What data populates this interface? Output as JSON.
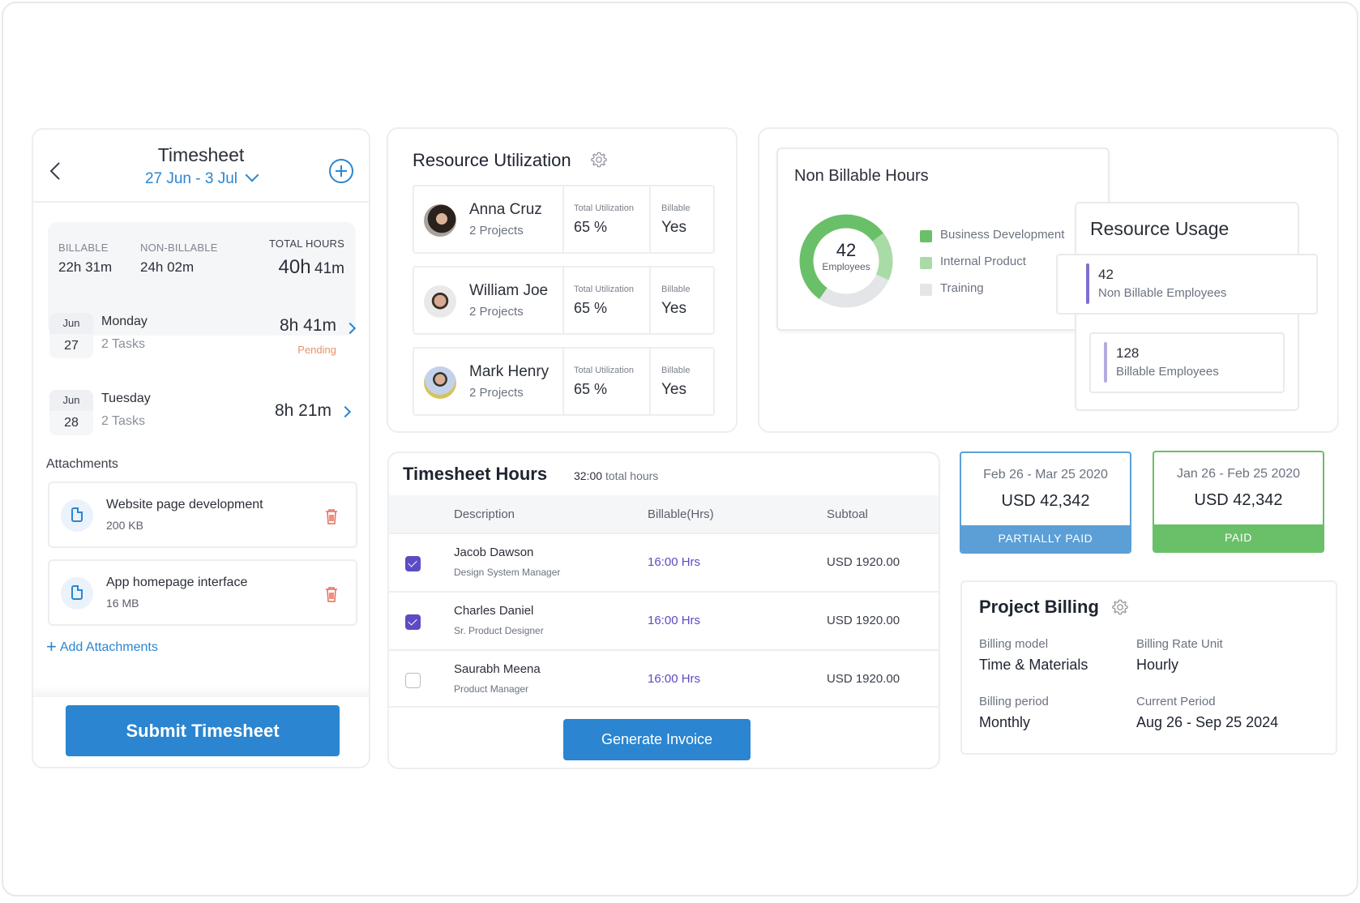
{
  "timesheet": {
    "title": "Timesheet",
    "date_range": "27 Jun - 3 Jul",
    "stats": {
      "billable_label": "BILLABLE",
      "billable_value": "22h 31m",
      "non_billable_label": "NON-BILLABLE",
      "non_billable_value": "24h 02m",
      "total_label": "TOTAL HOURS",
      "total_hours": "40h",
      "total_minutes": "41m"
    },
    "days": [
      {
        "month": "Jun",
        "day": "27",
        "name": "Monday",
        "tasks": "2 Tasks",
        "hours": "8h 41m",
        "status": "Pending"
      },
      {
        "month": "Jun",
        "day": "28",
        "name": "Tuesday",
        "tasks": "2 Tasks",
        "hours": "8h 21m",
        "status": ""
      }
    ],
    "attachments_label": "Attachments",
    "attachments": [
      {
        "name": "Website page development",
        "size": "200 KB"
      },
      {
        "name": "App homepage interface",
        "size": "16 MB"
      }
    ],
    "add_attachments": "Add Attachments",
    "submit_label": "Submit Timesheet"
  },
  "resource_utilization": {
    "title": "Resource Utilization",
    "util_label": "Total Utilization",
    "billable_label": "Billable",
    "people": [
      {
        "name": "Anna Cruz",
        "projects": "2 Projects",
        "utilization": "65 %",
        "billable": "Yes"
      },
      {
        "name": "William Joe",
        "projects": "2 Projects",
        "utilization": "65 %",
        "billable": "Yes"
      },
      {
        "name": "Mark Henry",
        "projects": "2 Projects",
        "utilization": "65 %",
        "billable": "Yes"
      }
    ]
  },
  "non_billable": {
    "title": "Non Billable Hours",
    "center_value": "42",
    "center_label": "Employees",
    "segments": [
      {
        "label": "Business Development",
        "share": 0.55,
        "color": "#6abf69"
      },
      {
        "label": "Internal Product",
        "share": 0.17,
        "color": "#a9dba6"
      },
      {
        "label": "Training",
        "share": 0.28,
        "color": "#e3e5e8"
      }
    ]
  },
  "resource_usage": {
    "title": "Resource Usage",
    "items": [
      {
        "value": "42",
        "label": "Non Billable Employees",
        "color": "#7b6fd0"
      },
      {
        "value": "128",
        "label": "Billable Employees",
        "color": "#b3addf"
      }
    ]
  },
  "timesheet_hours": {
    "title": "Timesheet Hours",
    "total_value": "32:00",
    "total_unit": "total hours",
    "columns": [
      "Description",
      "Billable(Hrs)",
      "Subtoal"
    ],
    "rows": [
      {
        "checked": true,
        "name": "Jacob Dawson",
        "role": "Design System Manager",
        "hours": "16:00 Hrs",
        "subtotal": "USD 1920.00"
      },
      {
        "checked": true,
        "name": "Charles Daniel",
        "role": "Sr. Product Designer",
        "hours": "16:00 Hrs",
        "subtotal": "USD 1920.00"
      },
      {
        "checked": false,
        "name": "Saurabh Meena",
        "role": "Product Manager",
        "hours": "16:00 Hrs",
        "subtotal": "USD 1920.00"
      }
    ],
    "generate_label": "Generate Invoice"
  },
  "invoices": [
    {
      "dates": "Feb 26 - Mar 25 2020",
      "amount": "USD 42,342",
      "status": "PARTIALLY PAID",
      "color": "#5b9fd6"
    },
    {
      "dates": "Jan 26 - Feb 25 2020",
      "amount": "USD 42,342",
      "status": "PAID",
      "color": "#6abf69"
    }
  ],
  "project_billing": {
    "title": "Project Billing",
    "fields": [
      {
        "label": "Billing model",
        "value": "Time & Materials"
      },
      {
        "label": "Billing Rate Unit",
        "value": "Hourly"
      },
      {
        "label": "Billing period",
        "value": "Monthly"
      },
      {
        "label": "Current Period",
        "value": "Aug 26 - Sep 25 2024"
      }
    ]
  }
}
